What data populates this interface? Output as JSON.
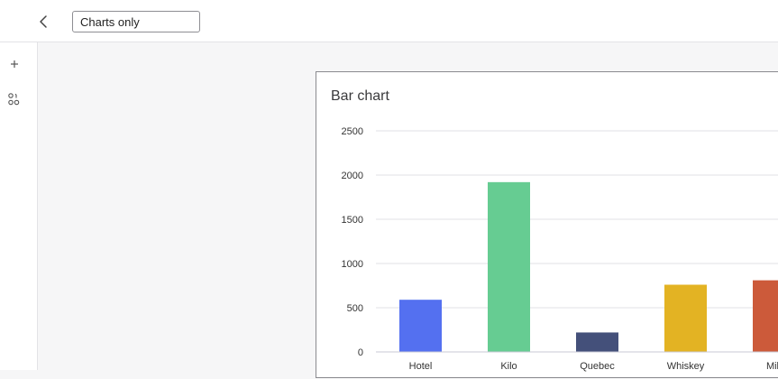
{
  "header": {
    "back_icon": "chevron-left-icon",
    "name_value": "Charts only"
  },
  "sidebar": {
    "items": [
      {
        "icon": "plus-icon"
      },
      {
        "icon": "widgets-icon"
      }
    ]
  },
  "chart": {
    "title": "Bar chart"
  },
  "chart_data": {
    "type": "bar",
    "title": "Bar chart",
    "categories": [
      "Hotel",
      "Kilo",
      "Quebec",
      "Whiskey",
      "Mik"
    ],
    "values": [
      590,
      1920,
      220,
      760,
      810
    ],
    "colors": [
      "#5470f0",
      "#66cc92",
      "#44507a",
      "#e3b323",
      "#cc5a3a"
    ],
    "ylim": [
      0,
      2500
    ],
    "yticks": [
      0,
      500,
      1000,
      1500,
      2000,
      2500
    ],
    "grid": true,
    "xlabel": "",
    "ylabel": ""
  }
}
